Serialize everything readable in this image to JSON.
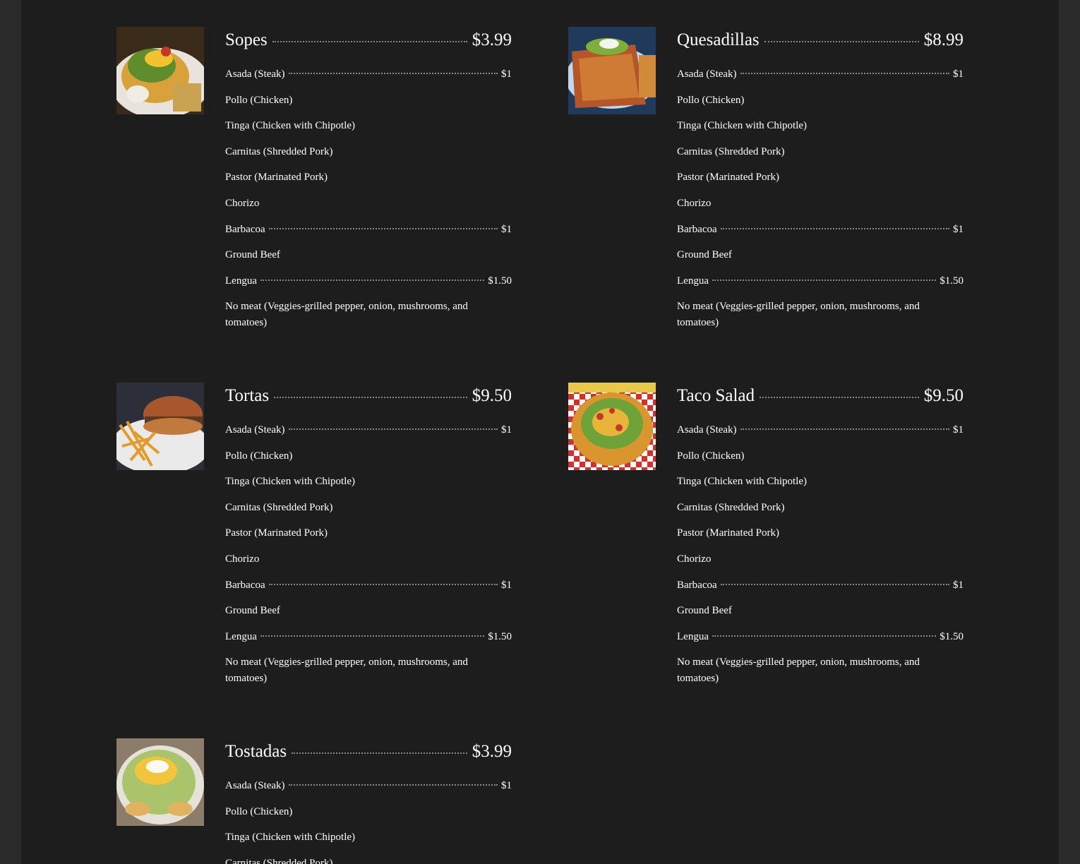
{
  "menu": {
    "items": [
      {
        "name": "Sopes",
        "price": "$3.99",
        "image": "sopes-photo",
        "options": [
          {
            "label": "Asada (Steak)",
            "price": "$1"
          },
          {
            "label": "Pollo (Chicken)",
            "price": ""
          },
          {
            "label": "Tinga (Chicken with Chipotle)",
            "price": ""
          },
          {
            "label": "Carnitas (Shredded Pork)",
            "price": ""
          },
          {
            "label": "Pastor (Marinated Pork)",
            "price": ""
          },
          {
            "label": "Chorizo",
            "price": ""
          },
          {
            "label": "Barbacoa",
            "price": "$1"
          },
          {
            "label": "Ground Beef",
            "price": ""
          },
          {
            "label": "Lengua",
            "price": "$1.50"
          },
          {
            "label": "No meat (Veggies-grilled pepper, onion, mushrooms, and tomatoes)",
            "price": ""
          }
        ]
      },
      {
        "name": "Quesadillas",
        "price": "$8.99",
        "image": "quesadillas-photo",
        "options": [
          {
            "label": "Asada (Steak)",
            "price": "$1"
          },
          {
            "label": "Pollo (Chicken)",
            "price": ""
          },
          {
            "label": "Tinga (Chicken with Chipotle)",
            "price": ""
          },
          {
            "label": "Carnitas (Shredded Pork)",
            "price": ""
          },
          {
            "label": "Pastor (Marinated Pork)",
            "price": ""
          },
          {
            "label": "Chorizo",
            "price": ""
          },
          {
            "label": "Barbacoa",
            "price": "$1"
          },
          {
            "label": "Ground Beef",
            "price": ""
          },
          {
            "label": "Lengua",
            "price": "$1.50"
          },
          {
            "label": "No meat (Veggies-grilled pepper, onion, mushrooms, and tomatoes)",
            "price": ""
          }
        ]
      },
      {
        "name": "Tortas",
        "price": "$9.50",
        "image": "tortas-photo",
        "options": [
          {
            "label": "Asada (Steak)",
            "price": "$1"
          },
          {
            "label": "Pollo (Chicken)",
            "price": ""
          },
          {
            "label": "Tinga (Chicken with Chipotle)",
            "price": ""
          },
          {
            "label": "Carnitas (Shredded Pork)",
            "price": ""
          },
          {
            "label": "Pastor (Marinated Pork)",
            "price": ""
          },
          {
            "label": "Chorizo",
            "price": ""
          },
          {
            "label": "Barbacoa",
            "price": "$1"
          },
          {
            "label": "Ground Beef",
            "price": ""
          },
          {
            "label": "Lengua",
            "price": "$1.50"
          },
          {
            "label": "No meat (Veggies-grilled pepper, onion, mushrooms, and tomatoes)",
            "price": ""
          }
        ]
      },
      {
        "name": "Taco Salad",
        "price": "$9.50",
        "image": "taco-salad-photo",
        "options": [
          {
            "label": "Asada (Steak)",
            "price": "$1"
          },
          {
            "label": "Pollo (Chicken)",
            "price": ""
          },
          {
            "label": "Tinga (Chicken with Chipotle)",
            "price": ""
          },
          {
            "label": "Carnitas (Shredded Pork)",
            "price": ""
          },
          {
            "label": "Pastor (Marinated Pork)",
            "price": ""
          },
          {
            "label": "Chorizo",
            "price": ""
          },
          {
            "label": "Barbacoa",
            "price": "$1"
          },
          {
            "label": "Ground Beef",
            "price": ""
          },
          {
            "label": "Lengua",
            "price": "$1.50"
          },
          {
            "label": "No meat (Veggies-grilled pepper, onion, mushrooms, and tomatoes)",
            "price": ""
          }
        ]
      },
      {
        "name": "Tostadas",
        "price": "$3.99",
        "image": "tostadas-photo",
        "options": [
          {
            "label": "Asada (Steak)",
            "price": "$1"
          },
          {
            "label": "Pollo (Chicken)",
            "price": ""
          },
          {
            "label": "Tinga (Chicken with Chipotle)",
            "price": ""
          },
          {
            "label": "Carnitas (Shredded Pork)",
            "price": ""
          }
        ]
      }
    ]
  },
  "colors": {
    "page_background": "#1d1d1d",
    "outer_background": "#2b2b2b",
    "text": "#ffffff",
    "leader": "#8a8a8a"
  }
}
